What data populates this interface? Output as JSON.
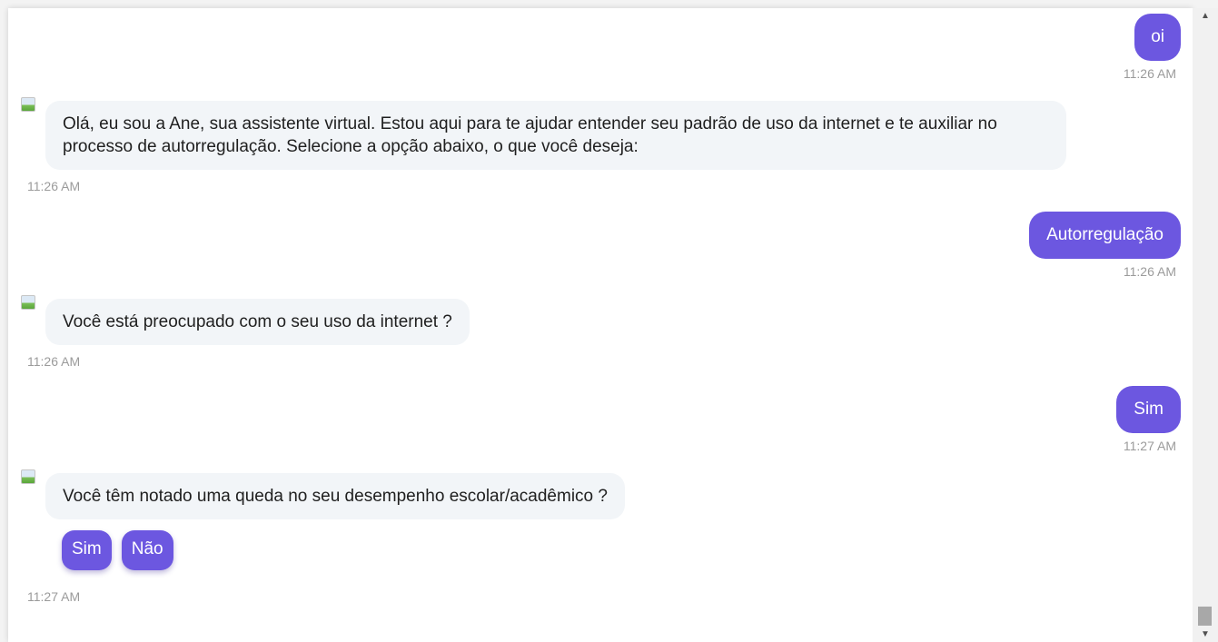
{
  "messages": [
    {
      "from": "user",
      "text": "oi",
      "time": "11:26 AM"
    },
    {
      "from": "bot",
      "text": "Olá, eu sou a Ane, sua assistente virtual. Estou aqui para te ajudar entender seu padrão de uso da internet e te auxiliar no processo de autorregulação. Selecione a opção abaixo, o que você deseja:",
      "time": "11:26 AM"
    },
    {
      "from": "user",
      "text": "Autorregulação",
      "time": "11:26 AM"
    },
    {
      "from": "bot",
      "text": "Você está preocupado com o seu uso da internet ?",
      "time": "11:26 AM"
    },
    {
      "from": "user",
      "text": "Sim",
      "time": "11:27 AM"
    },
    {
      "from": "bot",
      "text": "Você têm notado uma queda no seu desempenho escolar/acadêmico ?",
      "time": "11:27 AM"
    }
  ],
  "quick_replies": [
    "Sim",
    "Não"
  ],
  "colors": {
    "user_bubble": "#6c57e0",
    "bot_bubble": "#f2f5f8",
    "timestamp": "#9b9b9b"
  },
  "icons": {
    "avatar": "broken-image-icon",
    "scroll_up": "arrow-up-icon",
    "scroll_down": "arrow-down-icon"
  }
}
